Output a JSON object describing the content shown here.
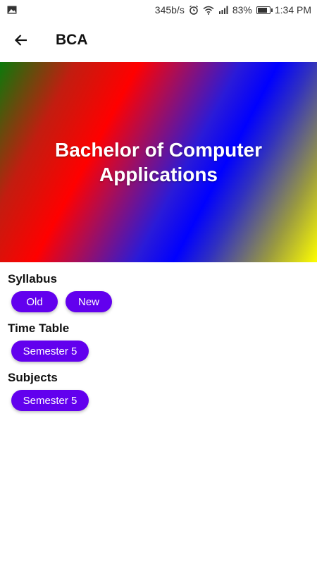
{
  "status_bar": {
    "speed": "345b/s",
    "battery": "83%",
    "time": "1:34 PM",
    "icons": [
      "image-icon",
      "alarm-icon",
      "wifi-icon",
      "signal-icon",
      "battery-icon"
    ]
  },
  "app_bar": {
    "title": "BCA",
    "back_icon": "arrow-left-icon"
  },
  "hero": {
    "title": "Bachelor of Computer Applications"
  },
  "sections": {
    "syllabus": {
      "label": "Syllabus",
      "buttons": [
        "Old",
        "New"
      ]
    },
    "time_table": {
      "label": "Time Table",
      "buttons": [
        "Semester 5"
      ]
    },
    "subjects": {
      "label": "Subjects",
      "buttons": [
        "Semester 5"
      ]
    }
  },
  "colors": {
    "chip": "#6200ee",
    "chip_text": "#ffffff"
  }
}
